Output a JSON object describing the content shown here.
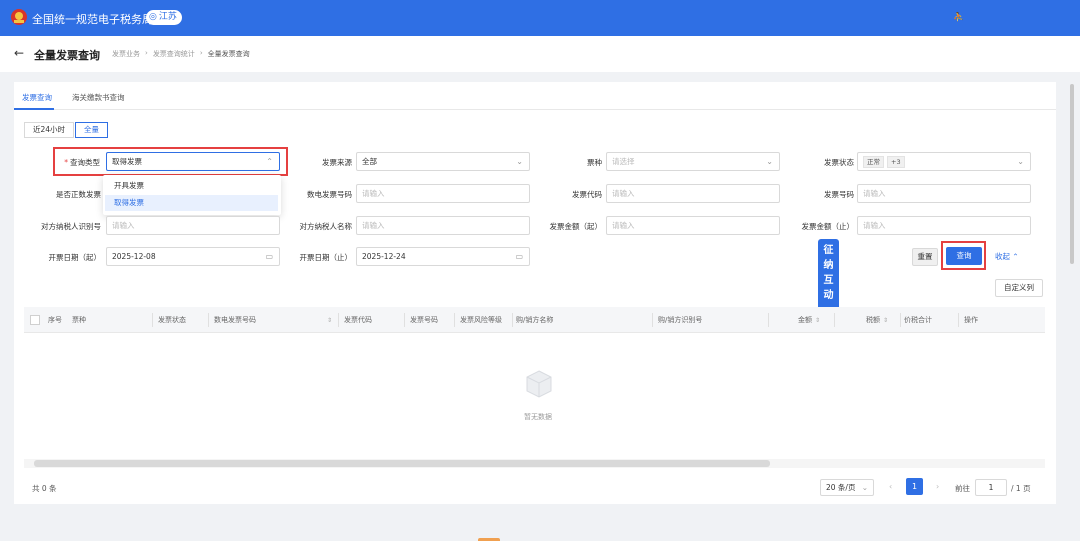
{
  "topbar": {
    "brand": "全国统一规范电子税务局",
    "region": "江苏"
  },
  "pagehead": {
    "back_icon": "arrow-left-icon",
    "title": "全量发票查询",
    "breadcrumbs": [
      "发票业务",
      "发票查询统计",
      "全量发票查询"
    ],
    "separator": "›"
  },
  "tabs": [
    {
      "label": "发票查询",
      "active": true
    },
    {
      "label": "海关缴款书查询",
      "active": false
    }
  ],
  "time_filter": [
    {
      "label": "近24小时",
      "active": false
    },
    {
      "label": "全量",
      "active": true
    }
  ],
  "form": {
    "query_type": {
      "label": "查询类型",
      "value": "取得发票"
    },
    "invoice_source": {
      "label": "发票来源",
      "value": "全部"
    },
    "ticket_type": {
      "label": "票种",
      "placeholder": "请选择"
    },
    "invoice_status": {
      "label": "发票状态",
      "tag": "正常",
      "more": "+3"
    },
    "is_positive": {
      "label": "是否正数发票"
    },
    "digital_number": {
      "label": "数电发票号码",
      "placeholder": "请输入"
    },
    "invoice_code": {
      "label": "发票代码",
      "placeholder": "请输入"
    },
    "invoice_number": {
      "label": "发票号码",
      "placeholder": "请输入"
    },
    "counterpart_id": {
      "label": "对方纳税人识别号",
      "placeholder": "请输入"
    },
    "counterpart_name": {
      "label": "对方纳税人名称",
      "placeholder": "请输入"
    },
    "amount_from": {
      "label": "发票金额（起）",
      "placeholder": "请输入"
    },
    "amount_to": {
      "label": "发票金额（止）",
      "placeholder": "请输入"
    },
    "date_from": {
      "label": "开票日期（起）",
      "value": "2025-12-08"
    },
    "date_to": {
      "label": "开票日期（止）",
      "value": "2025-12-24"
    }
  },
  "dropdown_options": [
    {
      "label": "开具发票",
      "selected": false
    },
    {
      "label": "取得发票",
      "selected": true
    }
  ],
  "buttons": {
    "reset": "重置",
    "query": "查询",
    "collapse": "收起",
    "custom_columns": "自定义列"
  },
  "float_tag": [
    "征",
    "纳",
    "互",
    "动"
  ],
  "table": {
    "columns": [
      "序号",
      "票种",
      "发票状态",
      "数电发票号码",
      "发票代码",
      "发票号码",
      "发票风险等级",
      "购/销方名称",
      "购/销方识别号",
      "金额",
      "税额",
      "价税合计",
      "操作"
    ],
    "empty_text": "暂无数据"
  },
  "pagination": {
    "total": "共 0 条",
    "page_size": "20 条/页",
    "current_page": "1",
    "goto_label": "前往",
    "goto_value": "1",
    "total_pages": "/ 1 页"
  },
  "colors": {
    "primary": "#2f6fe4",
    "highlight": "#e54040"
  }
}
